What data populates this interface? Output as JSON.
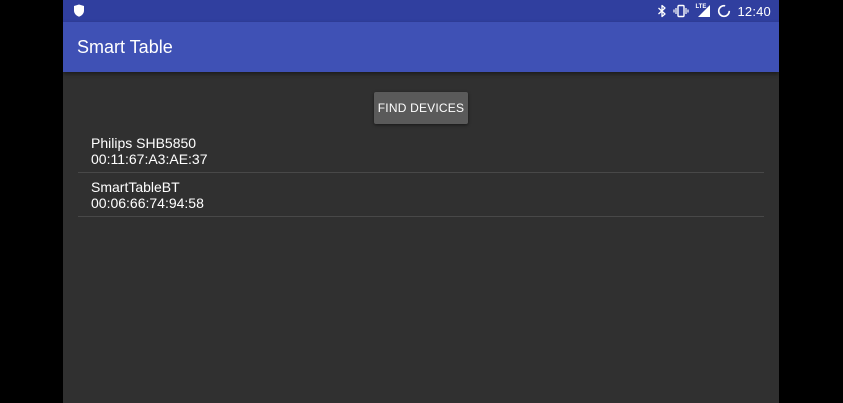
{
  "status_bar": {
    "time": "12:40",
    "network_label": "LTE",
    "icons": [
      "shield-icon",
      "bluetooth-icon",
      "vibrate-icon",
      "lte-icon",
      "signal-icon",
      "battery-charging-icon"
    ]
  },
  "app_bar": {
    "title": "Smart Table"
  },
  "main": {
    "find_button_label": "FIND DEVICES",
    "devices": [
      {
        "name": "Philips SHB5850",
        "address": "00:11:67:A3:AE:37"
      },
      {
        "name": "SmartTableBT",
        "address": "00:06:66:74:94:58"
      }
    ]
  },
  "colors": {
    "status_bar": "#303F9F",
    "app_bar": "#3F51B5",
    "background": "#303030",
    "button": "#5A5A5A"
  }
}
